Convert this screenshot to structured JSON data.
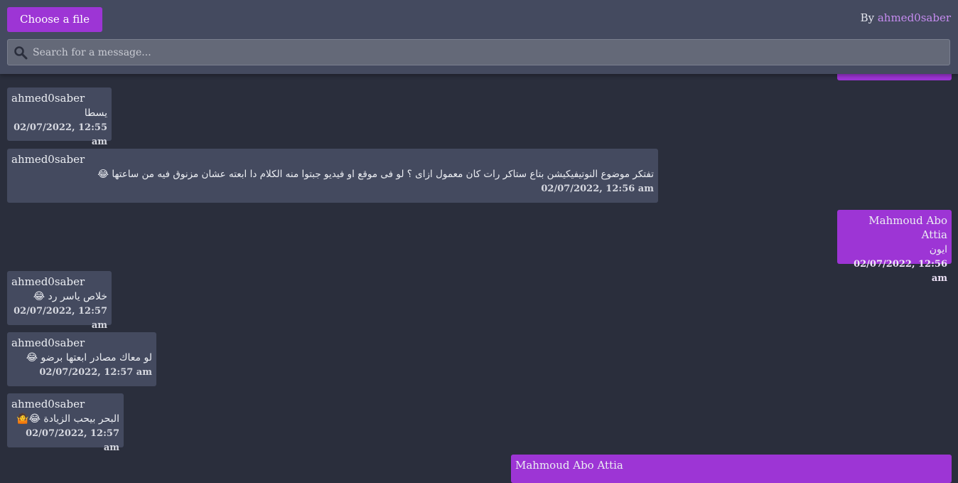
{
  "header": {
    "choose_file_label": "Choose a file",
    "by_label": "By",
    "author_link": "ahmed0saber",
    "search_placeholder": "Search for a message..."
  },
  "colors": {
    "accent": "#9d35d5",
    "background": "#2a2e3c",
    "header": "#444a5f",
    "bubble_other": "#444a5f"
  },
  "messages": [
    {
      "sender": "ahmed0saber",
      "text": "يسطا",
      "time": "02/07/2022, 12:55 am",
      "side": "other"
    },
    {
      "sender": "ahmed0saber",
      "text": "تفتكر موضوع النوتيفيكيشن بتاع ستاكر رات كان معمول ازاى ؟ لو فى موقع او فيديو جبتوا منه الكلام دا ابعته عشان مزنوق فيه من ساعتها 😂",
      "time": "02/07/2022, 12:56 am",
      "side": "other"
    },
    {
      "sender": "Mahmoud Abo Attia",
      "text": "ايون",
      "time": "02/07/2022, 12:56 am",
      "side": "mine"
    },
    {
      "sender": "ahmed0saber",
      "text": "خلاص ياسر رد 😂",
      "time": "02/07/2022, 12:57 am",
      "side": "other"
    },
    {
      "sender": "ahmed0saber",
      "text": "لو معاك مصادر ابعتها برضو 😂",
      "time": "02/07/2022, 12:57 am",
      "side": "other"
    },
    {
      "sender": "ahmed0saber",
      "text": "البحر بيحب الزيادة 😂🤷",
      "time": "02/07/2022, 12:57 am",
      "side": "other"
    },
    {
      "sender": "Mahmoud Abo Attia",
      "text": "",
      "time": "",
      "side": "mine"
    }
  ]
}
